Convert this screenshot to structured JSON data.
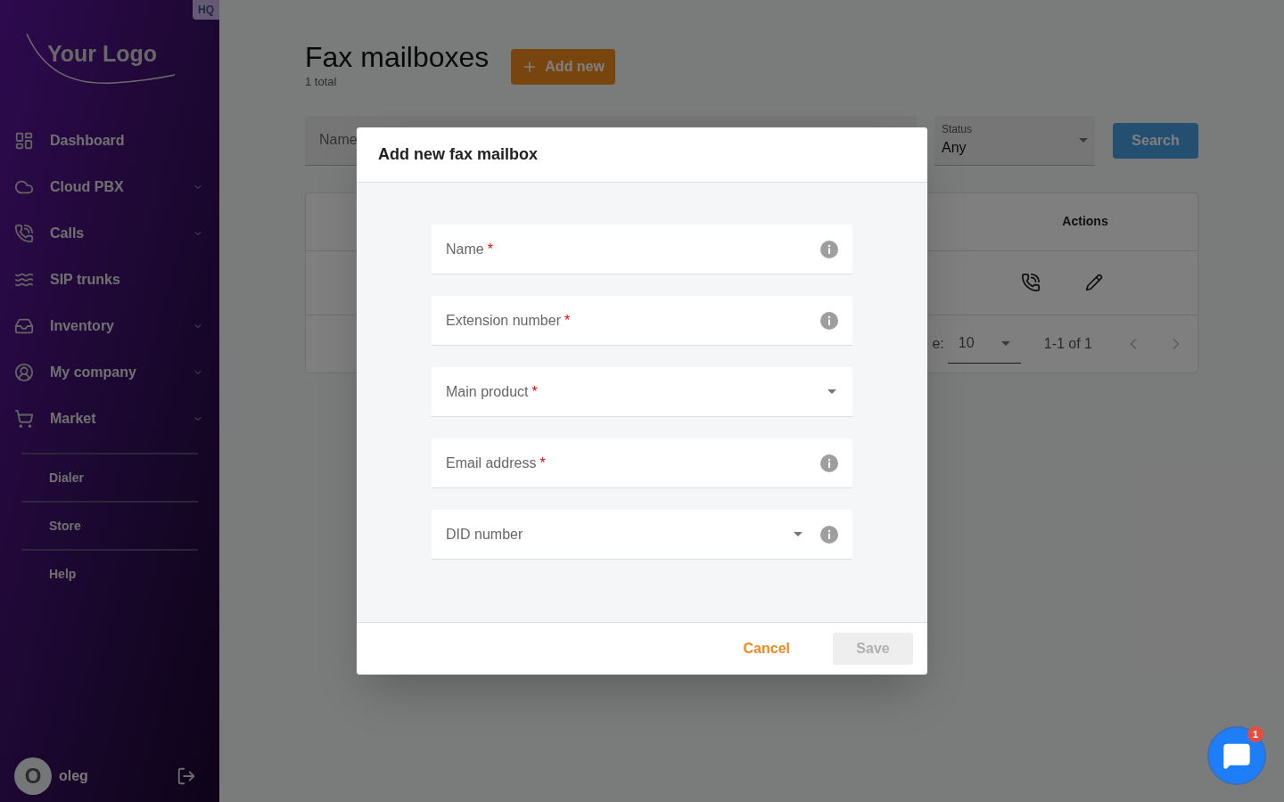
{
  "sidebar": {
    "badge": "HQ",
    "logo": "Your Logo",
    "items": [
      {
        "label": "Dashboard",
        "expandable": false
      },
      {
        "label": "Cloud PBX",
        "expandable": true
      },
      {
        "label": "Calls",
        "expandable": true
      },
      {
        "label": "SIP trunks",
        "expandable": false
      },
      {
        "label": "Inventory",
        "expandable": true
      },
      {
        "label": "My company",
        "expandable": true
      },
      {
        "label": "Market",
        "expandable": true
      }
    ],
    "links": [
      "Dialer",
      "Store",
      "Help"
    ],
    "user": {
      "initial": "O",
      "name": "oleg"
    }
  },
  "page": {
    "title": "Fax mailboxes",
    "count": "1 total",
    "add_button": "Add new",
    "filters": {
      "name_placeholder": "Name",
      "status_label": "Status",
      "status_value": "Any",
      "search_button": "Search"
    },
    "table": {
      "columns": [
        "Actions"
      ],
      "pagination": {
        "rows_label": "e:",
        "rows_value": "10",
        "range": "1-1 of 1"
      }
    }
  },
  "dialog": {
    "title": "Add new fax mailbox",
    "fields": [
      {
        "kind": "text",
        "label": "Name",
        "required": true,
        "info": true
      },
      {
        "kind": "text",
        "label": "Extension number",
        "required": true,
        "info": true
      },
      {
        "kind": "select",
        "label": "Main product",
        "required": true,
        "info": false
      },
      {
        "kind": "text",
        "label": "Email address",
        "required": true,
        "info": true
      },
      {
        "kind": "select",
        "label": "DID number",
        "required": false,
        "info": true
      }
    ],
    "required_mark": "*",
    "cancel": "Cancel",
    "save": {
      "label": "Save",
      "disabled": true
    }
  },
  "chat": {
    "badge": "1"
  }
}
